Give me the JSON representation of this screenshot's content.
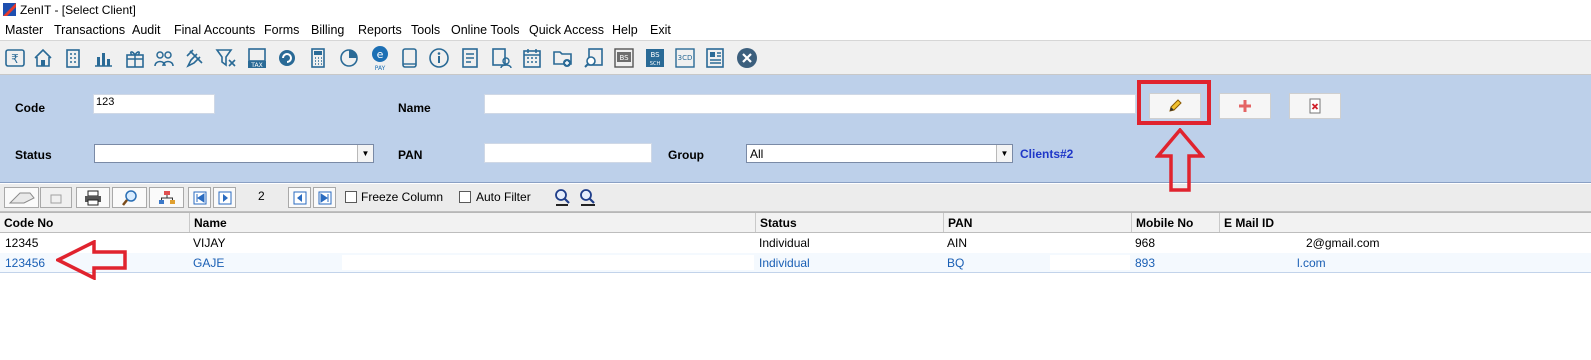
{
  "window": {
    "title": "ZenIT - [Select Client]"
  },
  "menu": [
    "Master",
    "Transactions",
    "Audit",
    "Final Accounts",
    "Forms",
    "Billing",
    "Reports",
    "Tools",
    "Online Tools",
    "Quick Access",
    "Help",
    "Exit"
  ],
  "toolbar_icons": [
    "rupee-icon",
    "home-icon",
    "building-icon",
    "chart-icon",
    "gift-icon",
    "users-icon",
    "pin-icon",
    "filter-icon",
    "tax-icon",
    "refresh-icon",
    "calculator-icon",
    "pie-icon",
    "epay-icon",
    "book-icon",
    "info-icon",
    "document-icon",
    "user-doc-icon",
    "calendar-icon",
    "folder-add-icon",
    "search-doc-icon",
    "bs-icon",
    "bs-sch-icon",
    "3cd-icon",
    "report-icon",
    "close-icon"
  ],
  "form": {
    "code_label": "Code",
    "code_value": "123",
    "name_label": "Name",
    "name_value": "",
    "status_label": "Status",
    "status_value": "",
    "pan_label": "PAN",
    "pan_value": "",
    "group_label": "Group",
    "group_value": "All",
    "clients_count": "Clients#2"
  },
  "gridbar": {
    "page": "2",
    "freeze_label": "Freeze Column",
    "autofilter_label": "Auto Filter"
  },
  "table": {
    "headers": [
      "Code No",
      "Name",
      "Status",
      "PAN",
      "Mobile No",
      "E Mail ID"
    ],
    "rows": [
      {
        "code": "12345",
        "name": "VIJAY",
        "status": "Individual",
        "pan": "AIN",
        "mobile": "968",
        "email": "2@gmail.com"
      },
      {
        "code": "123456",
        "name": "GAJE",
        "status": "Individual",
        "pan": "BQ",
        "mobile": "893",
        "email": "l.com"
      }
    ]
  },
  "colors": {
    "form_bg": "#bdd0ea",
    "annotation": "#e0232e",
    "selected_text": "#1a5fb4",
    "link": "#1f37c8"
  }
}
